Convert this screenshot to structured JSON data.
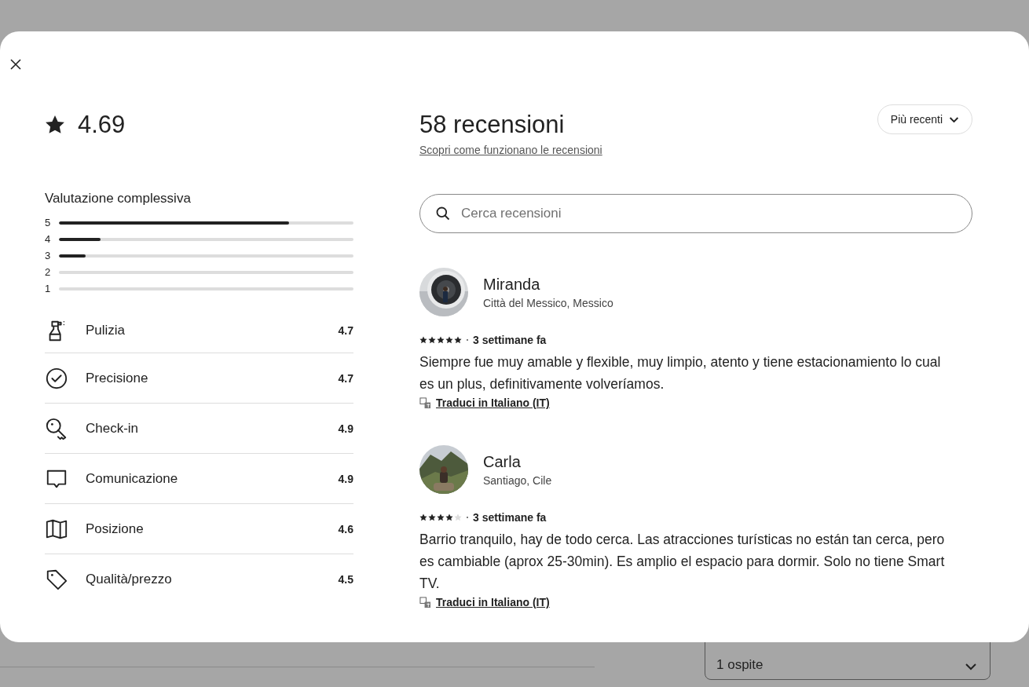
{
  "rating": {
    "value": "4.69"
  },
  "overall": {
    "title": "Valutazione complessiva",
    "bars": [
      {
        "label": "5",
        "level": 0.78
      },
      {
        "label": "4",
        "level": 0.14
      },
      {
        "label": "3",
        "level": 0.09
      },
      {
        "label": "2",
        "level": 0
      },
      {
        "label": "1",
        "level": 0
      }
    ]
  },
  "categories": [
    {
      "kind": "spray",
      "label": "Pulizia",
      "score": "4.7"
    },
    {
      "kind": "check",
      "label": "Precisione",
      "score": "4.7"
    },
    {
      "kind": "key",
      "label": "Check-in",
      "score": "4.9"
    },
    {
      "kind": "chat",
      "label": "Comunicazione",
      "score": "4.9"
    },
    {
      "kind": "map",
      "label": "Posizione",
      "score": "4.6"
    },
    {
      "kind": "tag",
      "label": "Qualità/prezzo",
      "score": "4.5"
    }
  ],
  "reviews_header": {
    "title": "58 recensioni",
    "link": "Scopri come funzionano le recensioni",
    "sort": "Più recenti"
  },
  "search": {
    "placeholder": "Cerca recensioni"
  },
  "reviews": [
    {
      "name": "Miranda",
      "location": "Città del Messico, Messico",
      "stars": 5,
      "time": "3 settimane fa",
      "text": "Siempre fue muy amable y flexible, muy limpio, atento y tiene estacionamiento lo cual es un plus, definitivamente volveríamos.",
      "translate": "Traduci in Italiano (IT)"
    },
    {
      "name": "Carla",
      "location": "Santiago, Cile",
      "stars": 4,
      "time": "3 settimane fa",
      "text": "Barrio tranquilo, hay de todo cerca. Las atracciones turísticas no están tan cerca, pero es cambiable (aprox 25-30min). Es amplio el espacio para dormir. Solo no tiene Smart TV.",
      "translate": "Traduci in Italiano (IT)"
    }
  ],
  "background": {
    "guests": "1 ospite"
  }
}
